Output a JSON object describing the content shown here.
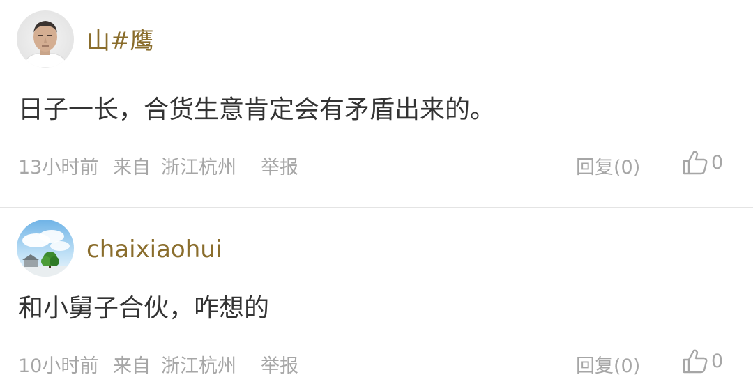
{
  "comments": [
    {
      "username": "山#鹰",
      "text": "日子一长，合货生意肯定会有矛盾出来的。",
      "time": "13小时前",
      "from_label": "来自",
      "location": "浙江杭州",
      "report_label": "举报",
      "reply_label": "回复(0)",
      "like_count": "0",
      "avatar_icon": "man-portrait-avatar"
    },
    {
      "username": "chaixiaohui",
      "text": "和小舅子合伙，咋想的",
      "time": "10小时前",
      "from_label": "来自",
      "location": "浙江杭州",
      "report_label": "举报",
      "reply_label": "回复(0)",
      "like_count": "0",
      "avatar_icon": "sky-tree-landscape-avatar"
    }
  ],
  "colors": {
    "username": "#8a6d2c",
    "body_text": "#333333",
    "meta_text": "#a6a6a6",
    "divider": "#e4e4e4"
  }
}
